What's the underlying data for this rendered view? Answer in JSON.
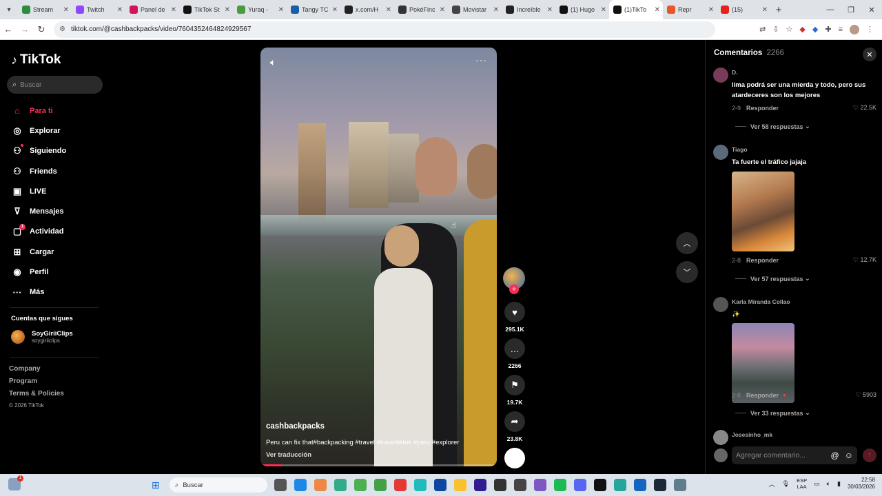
{
  "browser": {
    "tabs": [
      {
        "title": "Stream",
        "fav": "#2d8d3d"
      },
      {
        "title": "Twitch",
        "fav": "#9146ff"
      },
      {
        "title": "Panel de",
        "fav": "#d4145a"
      },
      {
        "title": "TikTok St",
        "fav": "#111111"
      },
      {
        "title": "Yuraq -",
        "fav": "#4b9b3e"
      },
      {
        "title": "Tangy TC",
        "fav": "#1b5ea8"
      },
      {
        "title": "x.com/H",
        "fav": "#222222"
      },
      {
        "title": "PokéFinc",
        "fav": "#333333"
      },
      {
        "title": "Movistar",
        "fav": "#444444"
      },
      {
        "title": "Increíble",
        "fav": "#222222"
      },
      {
        "title": "(1) Hugo",
        "fav": "#111111"
      },
      {
        "title": "(1)TikTo",
        "fav": "#111111"
      },
      {
        "title": "Repr",
        "fav": "#e8542c"
      },
      {
        "title": "(15)",
        "fav": "#e62117"
      }
    ],
    "url": "tiktok.com/@cashbackpacks/video/7604352464824929567"
  },
  "sidebar": {
    "logo": "TikTok",
    "search_placeholder": "Buscar",
    "nav": [
      {
        "label": "Para ti",
        "icon": "home-icon",
        "glyph": "⌂",
        "active": true
      },
      {
        "label": "Explorar",
        "icon": "compass-icon",
        "glyph": "◎"
      },
      {
        "label": "Siguiendo",
        "icon": "following-icon",
        "glyph": "⚇",
        "dot": true
      },
      {
        "label": "Friends",
        "icon": "friends-icon",
        "glyph": "⚇"
      },
      {
        "label": "LIVE",
        "icon": "live-icon",
        "glyph": "▣"
      },
      {
        "label": "Mensajes",
        "icon": "messages-icon",
        "glyph": "⊽"
      },
      {
        "label": "Actividad",
        "icon": "activity-icon",
        "glyph": "▢",
        "badge": "1"
      },
      {
        "label": "Cargar",
        "icon": "upload-icon",
        "glyph": "⊞"
      },
      {
        "label": "Perfil",
        "icon": "profile-icon",
        "glyph": "◉"
      },
      {
        "label": "Más",
        "icon": "more-icon",
        "glyph": "···"
      }
    ],
    "following_title": "Cuentas que sigues",
    "following": {
      "name": "SoyGiriiClips",
      "handle": "soygiriiclips"
    },
    "footer": [
      "Company",
      "Program",
      "Terms & Policies"
    ],
    "copyright": "© 2026 TikTok"
  },
  "video": {
    "author": "cashbackpacks",
    "caption": "Peru can fix that#backpacking #travel #traveltiktok #peru #explorer",
    "translate": "Ver traducción",
    "progress": 0.09
  },
  "actions": {
    "likes": "295.1K",
    "comments": "2266",
    "saves": "19.7K",
    "shares": "23.8K"
  },
  "comments_panel": {
    "title": "Comentarios",
    "count": "2266",
    "items": [
      {
        "user": "D.",
        "text": "lima podrá ser una mierda y todo, pero sus atardeceres son los mejores",
        "date": "2-9",
        "reply": "Responder",
        "likes": "22.5K",
        "more": "Ver 58 respuestas",
        "avatar": "#7a3a5a"
      },
      {
        "user": "Tiago",
        "text": "Ta fuerte el tráfico jajaja",
        "date": "2-8",
        "reply": "Responder",
        "likes": "12.7K",
        "more": "Ver 57 respuestas",
        "avatar": "#5a6a7a"
      },
      {
        "user": "Karla Miranda Collao",
        "text": "✨",
        "date": "2-8",
        "reply": "Responder",
        "likes": "5903",
        "more": "Ver 33 respuestas",
        "avatar": "#555555"
      },
      {
        "user": "Josesinho_mk",
        "avatar": "#888888"
      }
    ],
    "input_placeholder": "Agregar comentario..."
  },
  "taskbar": {
    "search": "Buscar",
    "lang": "ESP",
    "lang2": "LAA",
    "time": "22:58",
    "date": "30/03/2026",
    "weather_badge": "1"
  }
}
